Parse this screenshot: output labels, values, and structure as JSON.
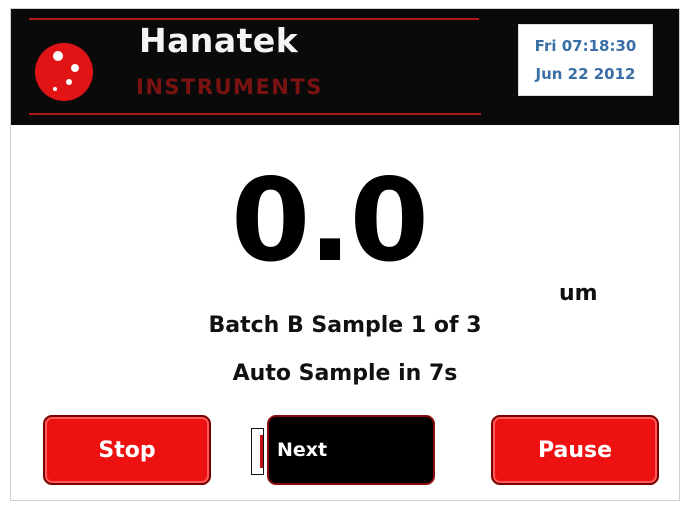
{
  "header": {
    "brand_name": "Hanatek",
    "brand_sub": "INSTRUMENTS",
    "date_line1": "Fri 07:18:30",
    "date_line2": "Jun 22 2012"
  },
  "measurement": {
    "value": "0.0",
    "unit": "um"
  },
  "status": {
    "batch_line": "Batch B Sample 1 of 3",
    "auto_line": "Auto Sample in 7s"
  },
  "buttons": {
    "stop": "Stop",
    "next": "Next",
    "pause": "Pause"
  },
  "colors": {
    "header_bg": "#0a0a0a",
    "accent_red": "#ee1111",
    "datetime_text": "#3a6fa6"
  },
  "icons": {
    "logo": "hanatek-logo-icon"
  }
}
